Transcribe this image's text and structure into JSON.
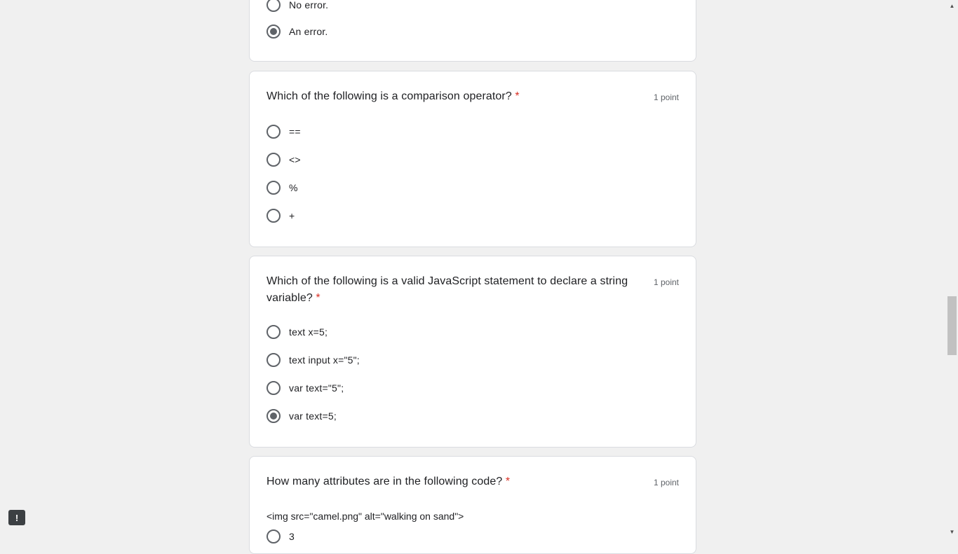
{
  "card1": {
    "options": [
      {
        "label": "No error.",
        "selected": false
      },
      {
        "label": "An error.",
        "selected": true
      }
    ]
  },
  "card2": {
    "question": "Which of the following is a comparison operator?",
    "required_marker": "*",
    "points": "1 point",
    "options": [
      {
        "label": "==",
        "selected": false
      },
      {
        "label": "<>",
        "selected": false
      },
      {
        "label": "%",
        "selected": false
      },
      {
        "label": "+",
        "selected": false
      }
    ]
  },
  "card3": {
    "question": "Which of the following is a valid JavaScript statement to declare a string variable?",
    "required_marker": "*",
    "points": "1 point",
    "options": [
      {
        "label": "text x=5;",
        "selected": false
      },
      {
        "label": "text input x=\"5\";",
        "selected": false
      },
      {
        "label": "var text=\"5\";",
        "selected": false
      },
      {
        "label": "var text=5;",
        "selected": true
      }
    ]
  },
  "card4": {
    "question": "How many attributes are in the following code?",
    "required_marker": "*",
    "points": "1 point",
    "code": "<img src=\"camel.png\" alt=\"walking on sand\">",
    "options": [
      {
        "label": "3",
        "selected": false
      }
    ]
  },
  "report_icon": "exclamation-icon",
  "scrollbar": {
    "position": 0.6
  }
}
